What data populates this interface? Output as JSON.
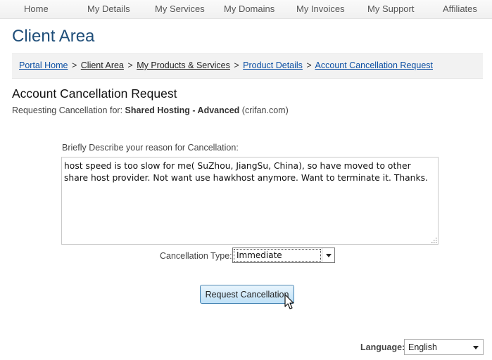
{
  "nav": {
    "items": [
      {
        "label": "Home"
      },
      {
        "label": "My Details"
      },
      {
        "label": "My Services"
      },
      {
        "label": "My Domains"
      },
      {
        "label": "My Invoices"
      },
      {
        "label": "My Support"
      },
      {
        "label": "Affiliates"
      }
    ]
  },
  "page_title": "Client Area",
  "breadcrumb": {
    "portal_home": "Portal Home",
    "client_area": "Client Area",
    "products_services": "My Products & Services",
    "product_details": "Product Details",
    "current": "Account Cancellation Request",
    "separator": ">"
  },
  "section_title": "Account Cancellation Request",
  "requesting": {
    "prefix": "Requesting Cancellation for:",
    "product": "Shared Hosting - Advanced",
    "domain": "(crifan.com)"
  },
  "form": {
    "reason_label": "Briefly Describe your reason for Cancellation:",
    "reason_value": "host speed is too slow for me( SuZhou, JiangSu, China), so have moved to other share host provider. Not want use hawkhost anymore. Want to terminate it. Thanks.",
    "cancellation_type_label": "Cancellation Type:",
    "cancellation_type_value": "Immediate",
    "submit_label": "Request Cancellation"
  },
  "language": {
    "label": "Language:",
    "value": "English"
  }
}
